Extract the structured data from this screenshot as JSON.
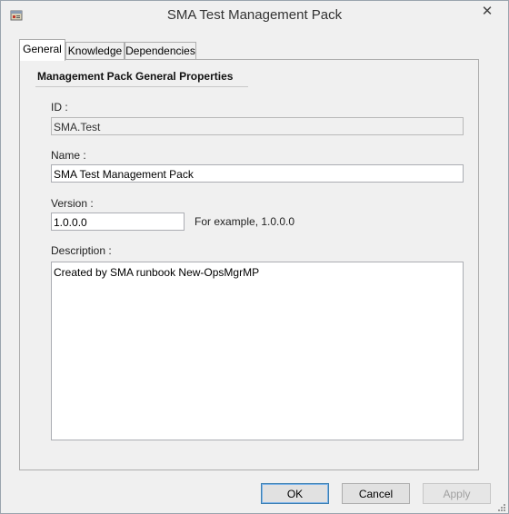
{
  "window": {
    "title": "SMA Test Management Pack"
  },
  "tabs": [
    {
      "label": "General",
      "active": true
    },
    {
      "label": "Knowledge",
      "active": false
    },
    {
      "label": "Dependencies",
      "active": false
    }
  ],
  "general": {
    "section_title": "Management Pack General Properties",
    "id_label": "ID :",
    "id_value": "SMA.Test",
    "name_label": "Name :",
    "name_value": "SMA Test Management Pack",
    "version_label": "Version :",
    "version_value": "1.0.0.0",
    "version_example": "For example, 1.0.0.0",
    "description_label": "Description :",
    "description_value": "Created by SMA runbook New-OpsMgrMP"
  },
  "buttons": {
    "ok": "OK",
    "cancel": "Cancel",
    "apply": "Apply"
  },
  "icons": {
    "app": "management-pack-icon",
    "close": "close-icon",
    "grip": "resize-grip-icon"
  },
  "colors": {
    "window_bg": "#f0f0f0",
    "default_button_border": "#3c7fb1"
  }
}
